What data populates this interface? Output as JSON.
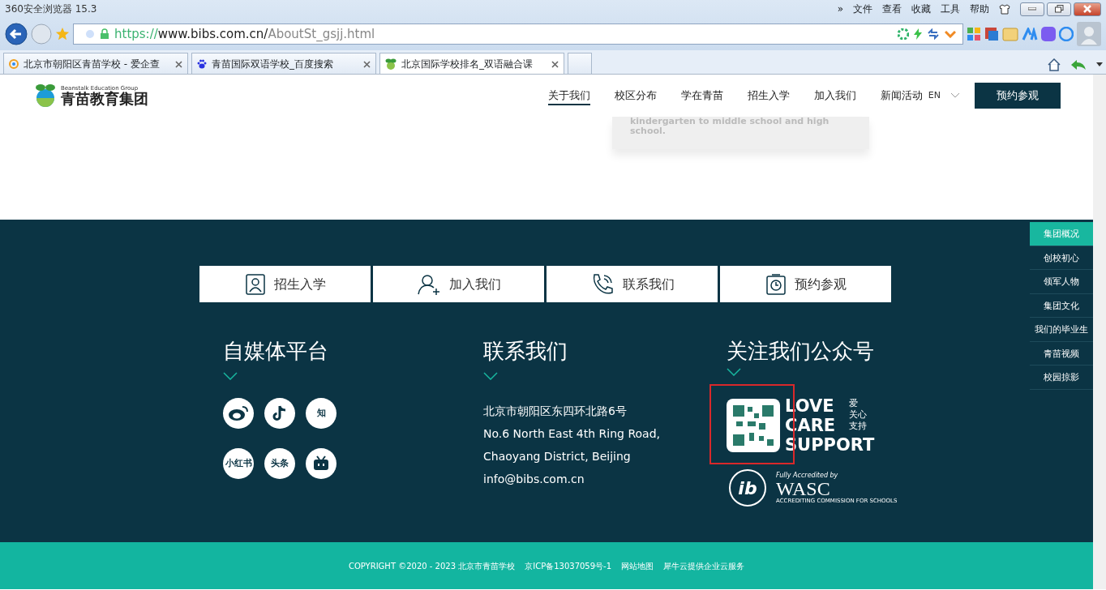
{
  "browser": {
    "title": "360安全浏览器 15.3",
    "menu": [
      "»",
      "文件",
      "查看",
      "收藏",
      "工具",
      "帮助"
    ],
    "url": {
      "scheme": "https://",
      "host": "www.bibs.com.cn/",
      "path": "AboutSt_gsjj.html"
    },
    "tabs": [
      {
        "label": "北京市朝阳区青苗学校 - 爱企查",
        "selected": false
      },
      {
        "label": "青苗国际双语学校_百度搜索",
        "selected": false
      },
      {
        "label": "北京国际学校排名_双语融合课",
        "selected": true
      }
    ]
  },
  "site": {
    "logo": {
      "en": "Beanstalk Education Group",
      "zh": "青苗教育集团"
    },
    "nav": [
      {
        "label": "关于我们",
        "selected": true
      },
      {
        "label": "校区分布",
        "selected": false
      },
      {
        "label": "学在青苗",
        "selected": false
      },
      {
        "label": "招生入学",
        "selected": false
      },
      {
        "label": "加入我们",
        "selected": false
      },
      {
        "label": "新闻活动",
        "selected": false
      }
    ],
    "lang": "EN",
    "cta": "预约参观",
    "card_text": "kindergarten to middle school and high school.",
    "quick_links": [
      "招生入学",
      "加入我们",
      "联系我们",
      "预约参观"
    ],
    "media": {
      "title": "自媒体平台",
      "items": [
        {
          "kind": "glyph"
        },
        {
          "kind": "glyph"
        },
        {
          "kind": "text",
          "label": "知"
        },
        {
          "kind": "text",
          "label": "小红书"
        },
        {
          "kind": "text",
          "label": "头条"
        },
        {
          "kind": "glyph"
        }
      ]
    },
    "contact": {
      "title": "联系我们",
      "lines": [
        "北京市朝阳区东四环北路6号",
        "No.6 North East 4th Ring Road,",
        "Chaoyang District, Beijing",
        "info@bibs.com.cn"
      ]
    },
    "follow": {
      "title": "关注我们公众号",
      "slogan_en": [
        "LOVE",
        "CARE",
        "SUPPORT"
      ],
      "slogan_zh": [
        "爱",
        "关心",
        "支持"
      ],
      "ib": "ib",
      "wasc_top": "Fully Accredited by",
      "wasc": "WASC",
      "wasc_bottom": "ACCREDITING COMMISSION FOR SCHOOLS"
    },
    "side_nav": [
      {
        "label": "集团概况",
        "selected": true
      },
      {
        "label": "创校初心",
        "selected": false
      },
      {
        "label": "领军人物",
        "selected": false
      },
      {
        "label": "集团文化",
        "selected": false
      },
      {
        "label": "我们的毕业生",
        "selected": false
      },
      {
        "label": "青苗视频",
        "selected": false
      },
      {
        "label": "校园掠影",
        "selected": false
      }
    ],
    "footer": [
      "COPYRIGHT ©2020 - 2023 北京市青苗学校",
      "京ICP备13037059号-1",
      "网站地图",
      "犀牛云提供企业云服务"
    ]
  }
}
